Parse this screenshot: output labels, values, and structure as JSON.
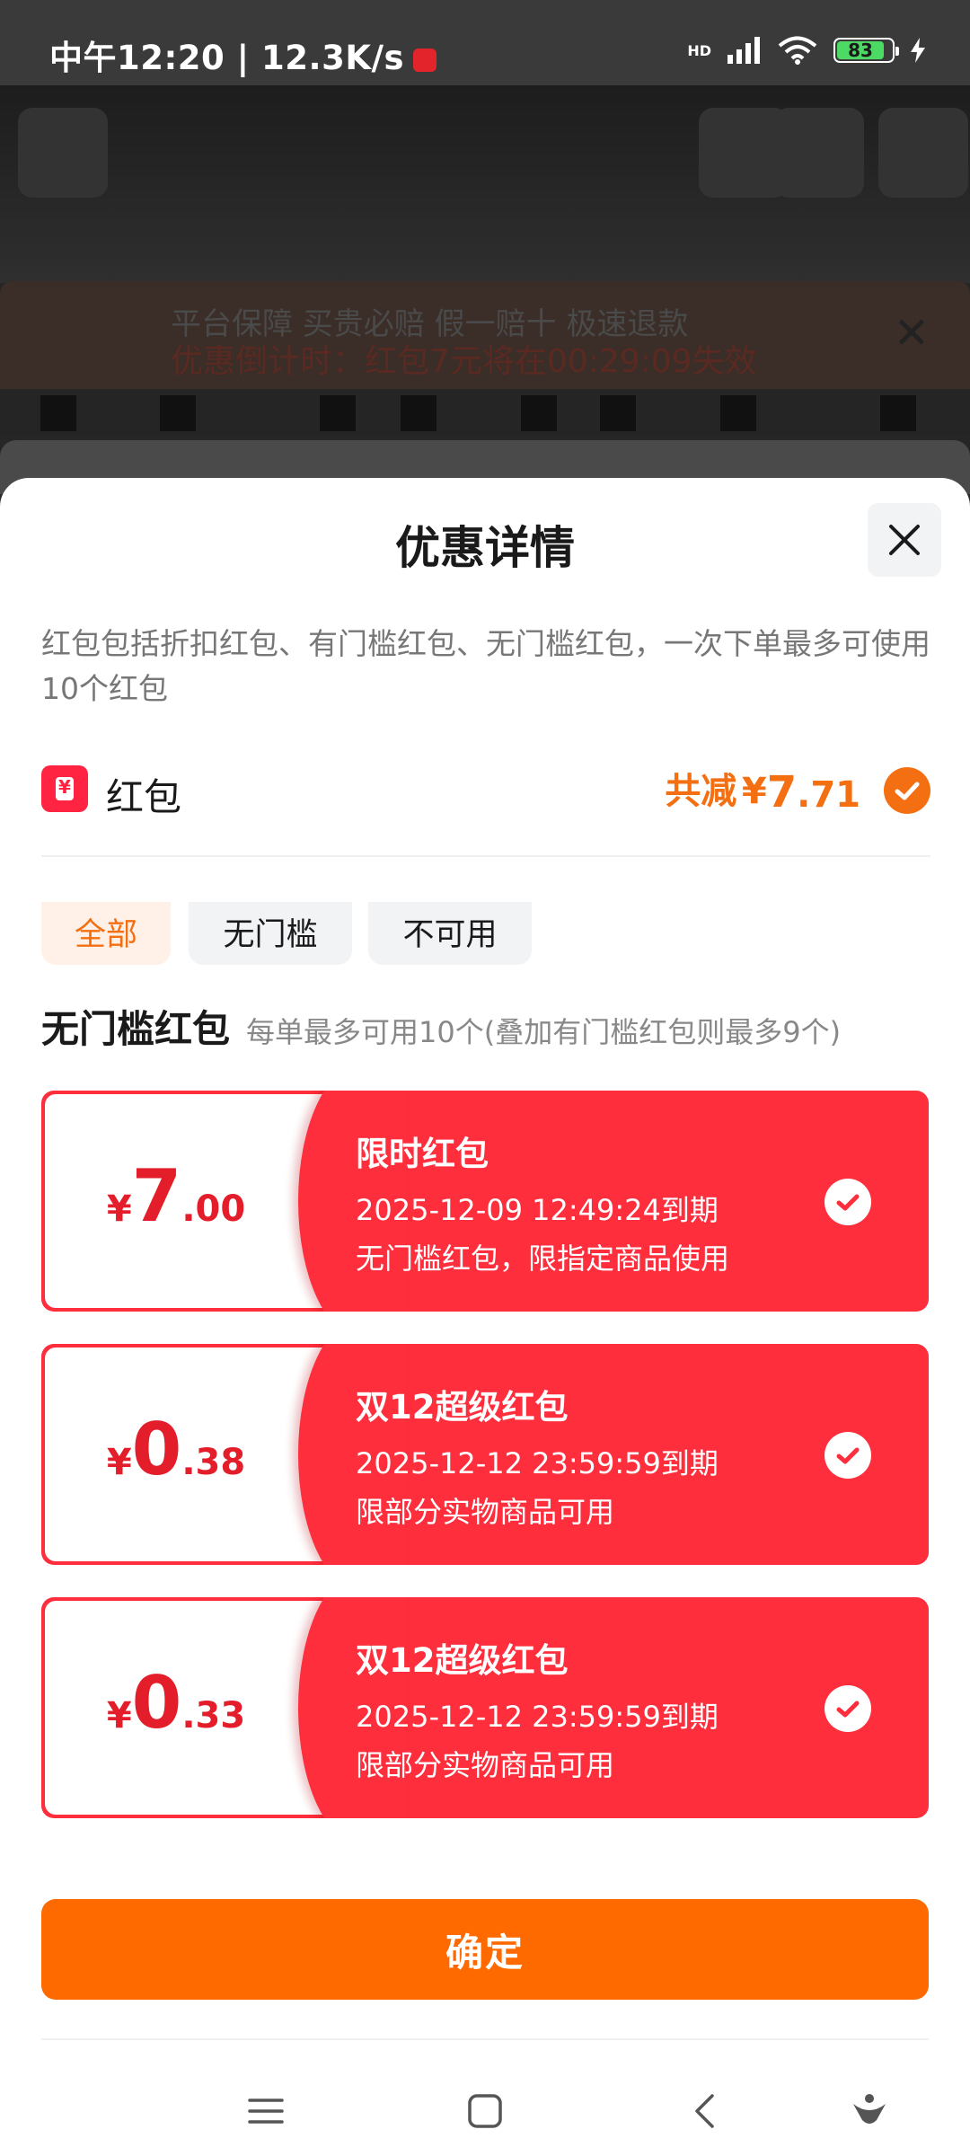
{
  "status_bar": {
    "time": "中午12:20 | 12.3K/s",
    "network": "HD",
    "battery": "83"
  },
  "background": {
    "notice_line1": "平台保障 买贵必赔 假一赔十 极速退款",
    "notice_line2": "优惠倒计时：红包7元将在00:29:09失效"
  },
  "sheet": {
    "title": "优惠详情",
    "description": "红包包括折扣红包、有门槛红包、无门槛红包，一次下单最多可使用10个红包",
    "redpacket_label": "红包",
    "total_prefix": "共减",
    "total_currency": "¥",
    "total_int": "7",
    "total_dec": ".71",
    "tabs": [
      "全部",
      "无门槛",
      "不可用"
    ],
    "section_title": "无门槛红包",
    "section_sub": "每单最多可用10个(叠加有门槛红包则最多9个)",
    "coupons": [
      {
        "currency": "¥",
        "int": "7",
        "dec": ".00",
        "name": "限时红包",
        "expiry": "2025-12-09 12:49:24到期",
        "note": "无门槛红包，限指定商品使用"
      },
      {
        "currency": "¥",
        "int": "0",
        "dec": ".38",
        "name": "双12超级红包",
        "expiry": "2025-12-12 23:59:59到期",
        "note": "限部分实物商品可用"
      },
      {
        "currency": "¥",
        "int": "0",
        "dec": ".33",
        "name": "双12超级红包",
        "expiry": "2025-12-12 23:59:59到期",
        "note": "限部分实物商品可用"
      }
    ],
    "confirm_label": "确定"
  },
  "colors": {
    "accent": "#ff6a00",
    "coupon_red": "#fe2e3c",
    "price_red": "#e31d2a"
  },
  "icons": [
    "close-icon",
    "check-icon",
    "menu-icon",
    "home-icon",
    "back-icon",
    "assistant-icon"
  ]
}
